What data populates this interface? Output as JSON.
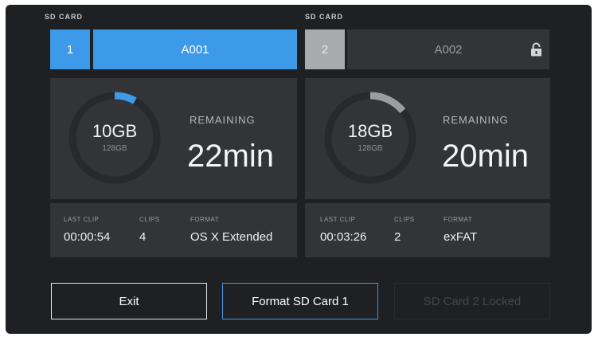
{
  "slots": [
    {
      "label": "SD CARD",
      "number": "1",
      "name": "A001",
      "active": true,
      "locked": false,
      "used": "10GB",
      "capacity": "128GB",
      "used_fraction": 0.08,
      "remaining_label": "REMAINING",
      "remaining": "22min",
      "last_clip_label": "LAST CLIP",
      "last_clip": "00:00:54",
      "clips_label": "CLIPS",
      "clips": "4",
      "format_label": "FORMAT",
      "format": "OS X Extended"
    },
    {
      "label": "SD CARD",
      "number": "2",
      "name": "A002",
      "active": false,
      "locked": true,
      "lock_icon": "padlock-icon",
      "used": "18GB",
      "capacity": "128GB",
      "used_fraction": 0.14,
      "remaining_label": "REMAINING",
      "remaining": "20min",
      "last_clip_label": "LAST CLIP",
      "last_clip": "00:03:26",
      "clips_label": "CLIPS",
      "clips": "2",
      "format_label": "FORMAT",
      "format": "exFAT"
    }
  ],
  "buttons": {
    "exit": "Exit",
    "format_card1": "Format SD Card 1",
    "card2_locked": "SD Card 2 Locked"
  },
  "colors": {
    "accent": "#3d9ae8",
    "inactive_slot": "#a9aaad",
    "used_arc_inactive": "#9c9da0",
    "panel": "#333437",
    "background": "#1f2023"
  }
}
